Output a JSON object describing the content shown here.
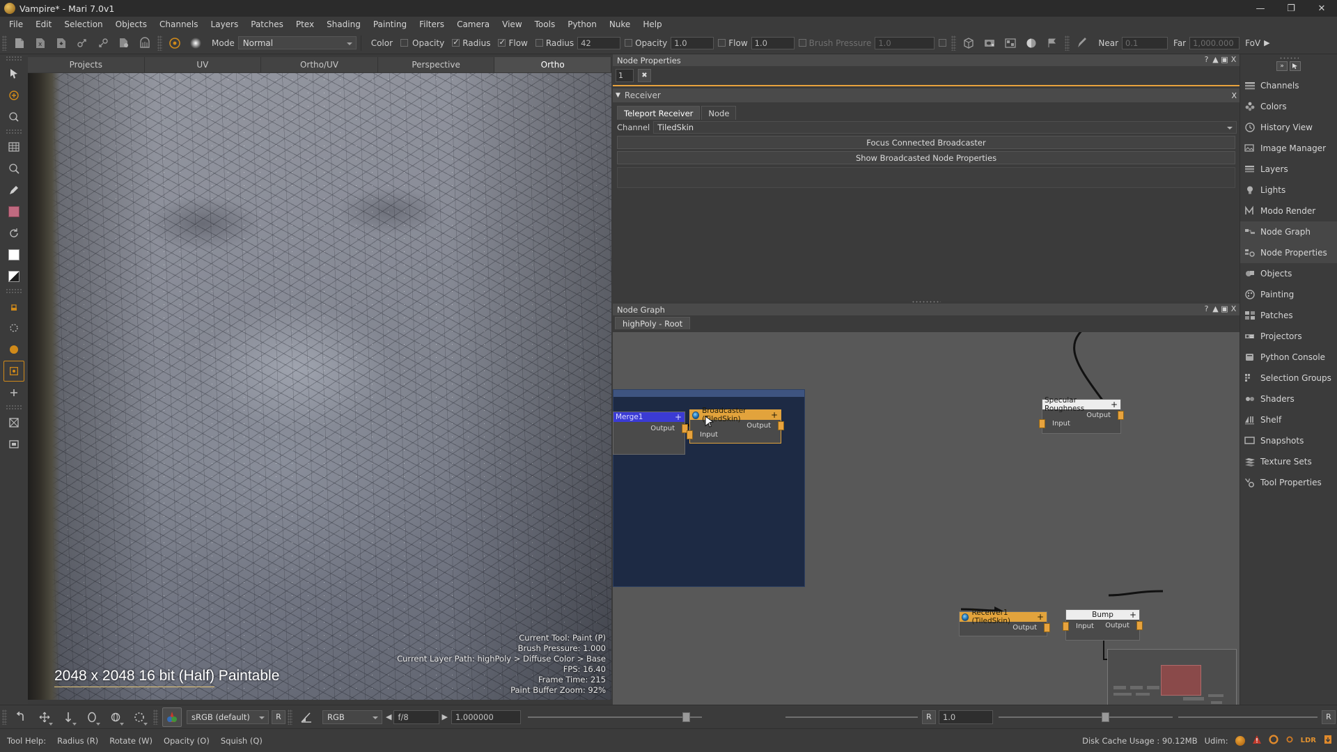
{
  "window": {
    "title": "Vampire* - Mari 7.0v1",
    "app_icon": "mari-logo-icon",
    "minimize": "—",
    "maximize": "❐",
    "close": "✕"
  },
  "menubar": {
    "items": [
      "File",
      "Edit",
      "Selection",
      "Objects",
      "Channels",
      "Layers",
      "Patches",
      "Ptex",
      "Shading",
      "Painting",
      "Filters",
      "Camera",
      "View",
      "Tools",
      "Python",
      "Nuke",
      "Help"
    ]
  },
  "toolbar": {
    "mode_label": "Mode",
    "mode_value": "Normal",
    "color_label": "Color",
    "color_checked": false,
    "opacity_label": "Opacity",
    "opacity_checked": false,
    "radius_check_label": "Radius",
    "radius_checked": true,
    "flow_check_label": "Flow",
    "flow_checked": true,
    "radius_label": "Radius",
    "radius_value": "42",
    "opacity_field_label": "Opacity",
    "opacity_value": "1.0",
    "flow_field_label": "Flow",
    "flow_value": "1.0",
    "brush_pressure_label": "Brush Pressure",
    "brush_pressure_value": "1.0",
    "near_label": "Near",
    "near_value": "0.1",
    "far_label": "Far",
    "far_value": "1,000.000",
    "fov_label": "FoV",
    "fov_arrow": "▶"
  },
  "viewport": {
    "tabs": [
      {
        "label": "Projects",
        "active": false
      },
      {
        "label": "UV",
        "active": false
      },
      {
        "label": "Ortho/UV",
        "active": false
      },
      {
        "label": "Perspective",
        "active": false
      },
      {
        "label": "Ortho",
        "active": true
      }
    ],
    "resolution_text": "2048 x 2048 16 bit (Half) Paintable",
    "info_lines": [
      "Current Tool: Paint (P)",
      "Brush Pressure: 1.000",
      "Current Layer Path: highPoly > Diffuse Color > Base",
      "FPS: 16.40",
      "Frame Time: 215",
      "Paint Buffer Zoom: 92%"
    ]
  },
  "node_properties": {
    "panel_title": "Node Properties",
    "panel_buttons": [
      "?",
      "▲",
      "▣",
      "X"
    ],
    "index_value": "1",
    "pin_label": "✖",
    "section_title": "Receiver",
    "section_collapse": "▼",
    "section_close": "X",
    "tabs": [
      {
        "label": "Teleport Receiver",
        "active": true
      },
      {
        "label": "Node",
        "active": false
      }
    ],
    "channel_label": "Channel",
    "channel_value": "TiledSkin",
    "buttons": [
      "Focus Connected Broadcaster",
      "Show Broadcasted Node Properties"
    ]
  },
  "node_graph": {
    "panel_title": "Node Graph",
    "panel_buttons": [
      "?",
      "▲",
      "▣",
      "X"
    ],
    "tab_label": "highPoly - Root",
    "nodes": [
      {
        "name": "Merge1",
        "header_style": "blue",
        "plus": "+",
        "output_label": "Output",
        "input_label": ""
      },
      {
        "name": "Broadcaster (TiledSkin)",
        "header_style": "orange",
        "plus": "+",
        "output_label": "Output",
        "input_label": "Input",
        "selected": true,
        "icon": "broadcaster-icon"
      },
      {
        "name": "Specular Roughness",
        "header_style": "white",
        "plus": "+",
        "output_label": "Output",
        "input_label": "Input"
      },
      {
        "name": "Receiver1 (TiledSkin)",
        "header_style": "orange",
        "plus": "+",
        "output_label": "Output",
        "input_label": "",
        "icon": "receiver-icon"
      },
      {
        "name": "Bump",
        "header_style": "white",
        "plus": "+",
        "output_label": "Output",
        "input_label": "Input"
      }
    ]
  },
  "palette": {
    "expand_icon": "»",
    "pointer_icon": "⬛",
    "items": [
      {
        "label": "Channels",
        "icon": "channels-icon",
        "active": false
      },
      {
        "label": "Colors",
        "icon": "colors-icon",
        "active": false
      },
      {
        "label": "History View",
        "icon": "history-icon",
        "active": false
      },
      {
        "label": "Image Manager",
        "icon": "image-manager-icon",
        "active": false
      },
      {
        "label": "Layers",
        "icon": "layers-icon",
        "active": false
      },
      {
        "label": "Lights",
        "icon": "lights-icon",
        "active": false
      },
      {
        "label": "Modo Render",
        "icon": "modo-render-icon",
        "active": false
      },
      {
        "label": "Node Graph",
        "icon": "node-graph-icon",
        "active": true
      },
      {
        "label": "Node Properties",
        "icon": "node-properties-icon",
        "active": true
      },
      {
        "label": "Objects",
        "icon": "objects-icon",
        "active": false
      },
      {
        "label": "Painting",
        "icon": "painting-icon",
        "active": false
      },
      {
        "label": "Patches",
        "icon": "patches-icon",
        "active": false
      },
      {
        "label": "Projectors",
        "icon": "projectors-icon",
        "active": false
      },
      {
        "label": "Python Console",
        "icon": "python-console-icon",
        "active": false
      },
      {
        "label": "Selection Groups",
        "icon": "selection-groups-icon",
        "active": false
      },
      {
        "label": "Shaders",
        "icon": "shaders-icon",
        "active": false
      },
      {
        "label": "Shelf",
        "icon": "shelf-icon",
        "active": false
      },
      {
        "label": "Snapshots",
        "icon": "snapshots-icon",
        "active": false
      },
      {
        "label": "Texture Sets",
        "icon": "texture-sets-icon",
        "active": false
      },
      {
        "label": "Tool Properties",
        "icon": "tool-properties-icon",
        "active": false
      }
    ]
  },
  "bottombar": {
    "colorspace_value": "sRGB (default)",
    "r_button": "R",
    "component_value": "RGB",
    "prev_arrow": "◀",
    "exposure_value": "f/8",
    "next_arrow": "▶",
    "gamma_value": "1.000000",
    "right_r_button": "R",
    "right_value": "1.0",
    "far_right_r": "R"
  },
  "statusbar": {
    "tool_help_label": "Tool Help:",
    "keys": [
      "Radius (R)",
      "Rotate (W)",
      "Opacity (O)",
      "Squish (Q)"
    ],
    "disk_cache": "Disk Cache Usage : 90.12MB",
    "udim_label": "Udim:",
    "ldr_label": "LDR"
  }
}
